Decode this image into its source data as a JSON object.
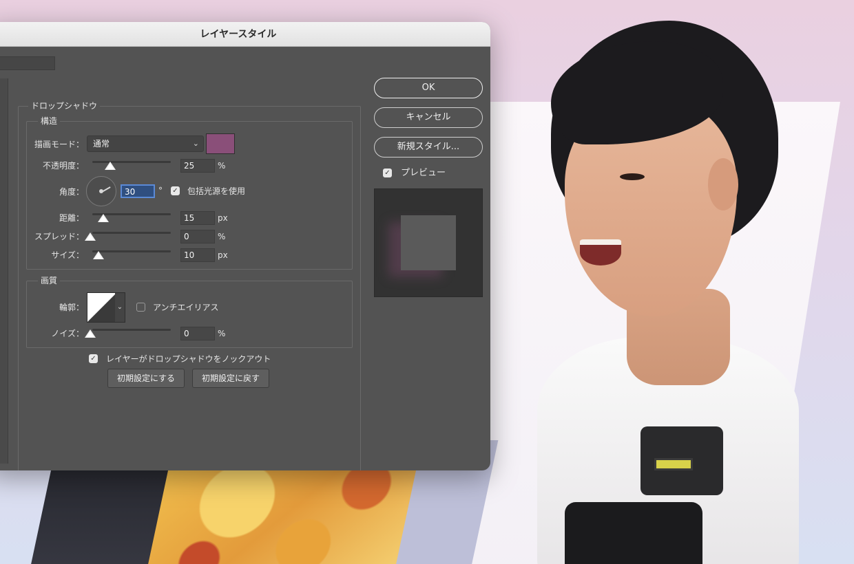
{
  "dialog": {
    "title": "レイヤースタイル",
    "ok_label": "OK",
    "cancel_label": "キャンセル",
    "new_style_label": "新規スタイル...",
    "preview_label": "プレビュー",
    "preview_checked": true
  },
  "drop_shadow": {
    "section_title": "ドロップシャドウ",
    "structure": {
      "title": "構造",
      "blend_mode_label": "描画モード：",
      "blend_mode_value": "通常",
      "shadow_color": "#8a4f79",
      "opacity_label": "不透明度：",
      "opacity_value": "25",
      "opacity_unit": "%",
      "angle_label": "角度：",
      "angle_value": "30",
      "angle_unit": "°",
      "global_light_label": "包括光源を使用",
      "global_light_checked": true,
      "distance_label": "距離：",
      "distance_value": "15",
      "distance_unit": "px",
      "spread_label": "スプレッド：",
      "spread_value": "0",
      "spread_unit": "%",
      "size_label": "サイズ：",
      "size_value": "10",
      "size_unit": "px"
    },
    "quality": {
      "title": "画質",
      "contour_label": "輪郭：",
      "anti_alias_label": "アンチエイリアス",
      "anti_alias_checked": false,
      "noise_label": "ノイズ：",
      "noise_value": "0",
      "noise_unit": "%"
    },
    "knockout_label": "レイヤーがドロップシャドウをノックアウト",
    "knockout_checked": true,
    "make_default_label": "初期設定にする",
    "reset_default_label": "初期設定に戻す"
  }
}
